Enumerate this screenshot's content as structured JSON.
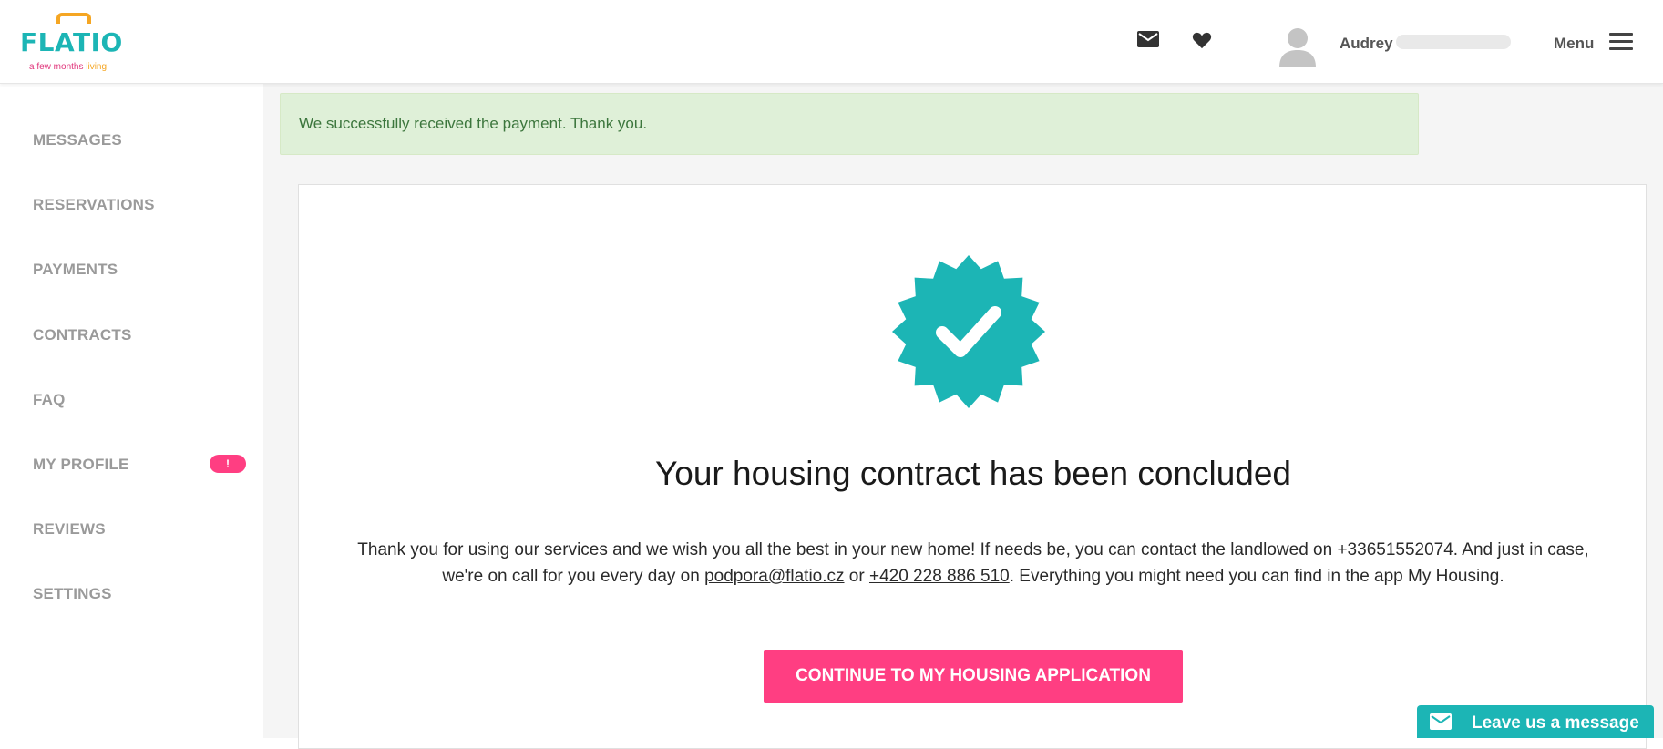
{
  "brand": {
    "name": "FLATIO",
    "tagline_prefix": "a few months",
    "tagline_highlight": "living"
  },
  "header": {
    "user_first_name": "Audrey",
    "menu_label": "Menu",
    "icons": [
      "mail-icon",
      "heart-icon",
      "avatar-icon",
      "hamburger-icon"
    ]
  },
  "sidebar": {
    "items": [
      {
        "label": "MESSAGES"
      },
      {
        "label": "RESERVATIONS"
      },
      {
        "label": "PAYMENTS"
      },
      {
        "label": "CONTRACTS"
      },
      {
        "label": "FAQ"
      },
      {
        "label": "MY PROFILE",
        "badge": "!"
      },
      {
        "label": "REVIEWS"
      },
      {
        "label": "SETTINGS"
      }
    ]
  },
  "alert": {
    "text": "We successfully received the payment. Thank you."
  },
  "card": {
    "icon": "verified-check-icon",
    "title": "Your housing contract has been concluded",
    "text_1": "Thank you for using our services and we wish you all the best in your new home! If needs be, you can contact the landlowed on +33651552074. And just in case, we're on call for you every day on ",
    "email": "podpora@flatio.cz",
    "text_2": " or ",
    "phone": "+420 228 886 510",
    "text_3": ". Everything you might need you can find in the app My Housing.",
    "button_label": "CONTINUE TO MY HOUSING APPLICATION"
  },
  "chat_widget": {
    "label": "Leave us a message"
  },
  "colors": {
    "brand_teal": "#1cb5b5",
    "accent_pink": "#ff3e82",
    "logo_orange": "#f5a623",
    "success_bg": "#dff0d8",
    "success_text": "#3c763d"
  }
}
